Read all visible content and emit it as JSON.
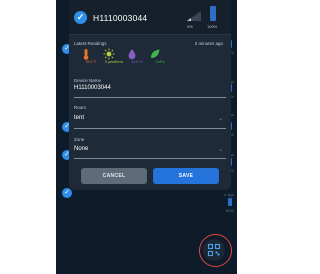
{
  "background_list": {
    "rows": [
      {
        "ago": "n ago",
        "battery_pct": "100%"
      },
      {
        "ago": "n ago",
        "battery_pct": "100%"
      },
      {
        "ago": "n ago",
        "battery_pct": "65%"
      },
      {
        "ago": "n ago",
        "battery_pct": "80%"
      },
      {
        "ago": "n ago",
        "battery_pct": "80%"
      },
      {
        "ago": "n ago",
        "battery_pct": "100%"
      }
    ]
  },
  "dialog": {
    "device_id": "H1110003044",
    "signal_pct": "4%",
    "battery_pct": "100%",
    "latest_readings_label": "Latest Readings",
    "readings_ago": "2 minutes ago",
    "readings": [
      {
        "icon": "thermometer-icon",
        "value": "78.5 °F",
        "color": "#e8742c"
      },
      {
        "icon": "sun-icon",
        "value": "0 μmol/m²/s",
        "color": "#b5d13a"
      },
      {
        "icon": "droplet-icon",
        "value": "44.5 %",
        "color": "#8a5cc7"
      },
      {
        "icon": "leaf-icon",
        "value": "0 kPa",
        "color": "#3fb54a"
      }
    ],
    "device_name_label": "Device Name",
    "device_name_value": "H1110003044",
    "room_label": "Room",
    "room_value": "tent",
    "zone_label": "Zone",
    "zone_value": "None",
    "cancel_label": "CANCEL",
    "save_label": "SAVE"
  },
  "colors": {
    "screen_bg": "#0d1b2a",
    "dialog_bg": "#1e2a38",
    "accent": "#2574dc",
    "fab_highlight": "#e04a3a"
  }
}
